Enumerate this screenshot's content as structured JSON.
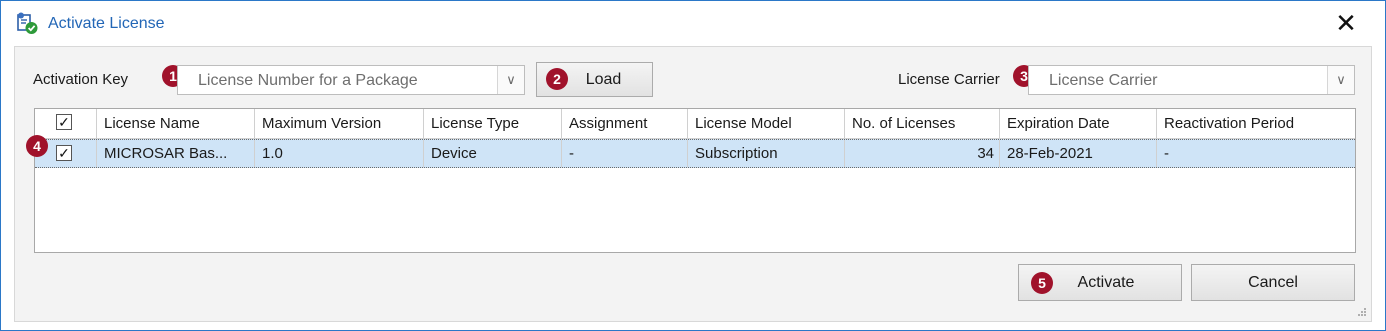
{
  "window": {
    "title": "Activate License",
    "close_glyph": "✕"
  },
  "activation": {
    "label": "Activation Key",
    "badge": "1",
    "value": "License Number for a Package",
    "arrow": "∨"
  },
  "load": {
    "badge": "2",
    "label": "Load"
  },
  "carrier": {
    "label": "License Carrier",
    "badge": "3",
    "value": "License Carrier",
    "arrow": "∨"
  },
  "grid": {
    "row_badge": "4",
    "columns": [
      "License Name",
      "Maximum Version",
      "License Type",
      "Assignment",
      "License Model",
      "No. of Licenses",
      "Expiration Date",
      "Reactivation Period"
    ],
    "rows": [
      {
        "checked": "✓",
        "cells": [
          "MICROSAR Bas...",
          "1.0",
          "Device",
          "-",
          "Subscription",
          "34",
          "28-Feb-2021",
          "-"
        ]
      }
    ],
    "header_check": "✓"
  },
  "buttons": {
    "activate_badge": "5",
    "activate": "Activate",
    "cancel": "Cancel"
  },
  "colors": {
    "badge": "#a0122b",
    "title": "#2266b6",
    "selection": "#cfe4f7"
  },
  "icons": {
    "app": "license-certificate-icon",
    "close": "close-icon",
    "dropdown": "chevron-down-icon"
  }
}
